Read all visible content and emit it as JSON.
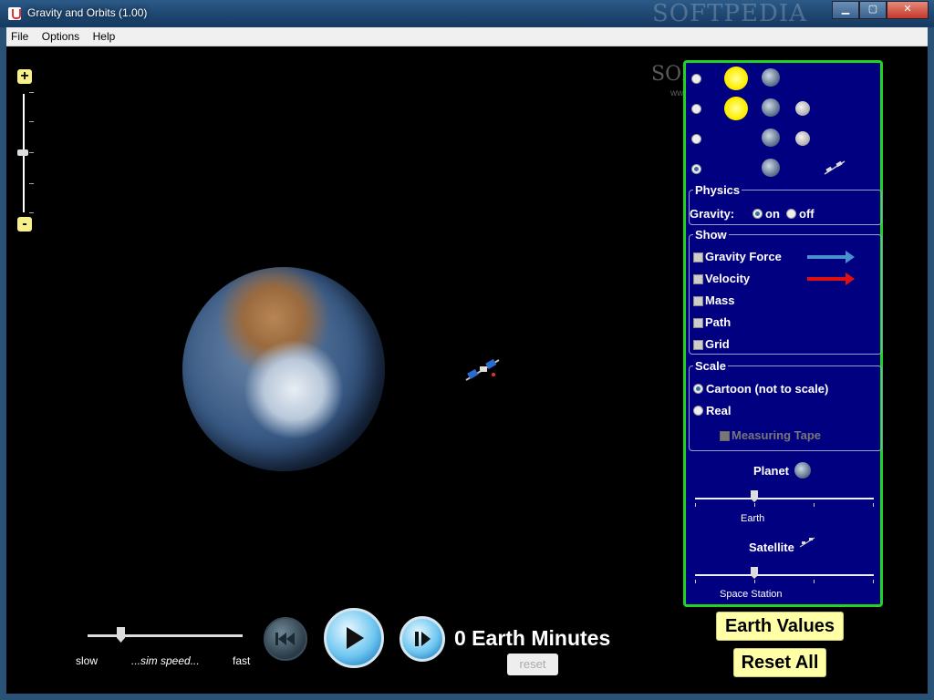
{
  "window": {
    "title": "Gravity and Orbits (1.00)",
    "watermark": "SOFTPEDIA",
    "minimize": "▁",
    "maximize": "▢",
    "close": "✕"
  },
  "menu": [
    "File",
    "Options",
    "Help"
  ],
  "zoom": {
    "plus": "+",
    "minus": "-"
  },
  "watermark_space": {
    "main": "SOFTPEDIA",
    "url": "www.softpedia.com"
  },
  "time_controls": {
    "slow": "slow",
    "speed_label": "...sim speed...",
    "fast": "fast",
    "elapsed": "0 Earth Minutes",
    "reset": "reset",
    "rewind_icon": "rewind-icon",
    "play_icon": "play-icon",
    "step_icon": "step-icon"
  },
  "panel": {
    "physics_title": "Physics",
    "gravity_label": "Gravity:",
    "gravity_on": "on",
    "gravity_off": "off",
    "show_title": "Show",
    "show_items": [
      "Gravity Force",
      "Velocity",
      "Mass",
      "Path",
      "Grid"
    ],
    "scale_title": "Scale",
    "scale_cartoon": "Cartoon (not to scale)",
    "scale_real": "Real",
    "measuring_tape": "Measuring Tape",
    "planet_label": "Planet",
    "planet_value": "Earth",
    "satellite_label": "Satellite",
    "satellite_value": "Space Station",
    "colors": {
      "gravity_arrow": "#4a8fd0",
      "velocity_arrow": "#e01010",
      "border": "#22d322",
      "panel": "#000080"
    }
  },
  "buttons": {
    "earth_values": "Earth Values",
    "reset_all": "Reset All"
  }
}
